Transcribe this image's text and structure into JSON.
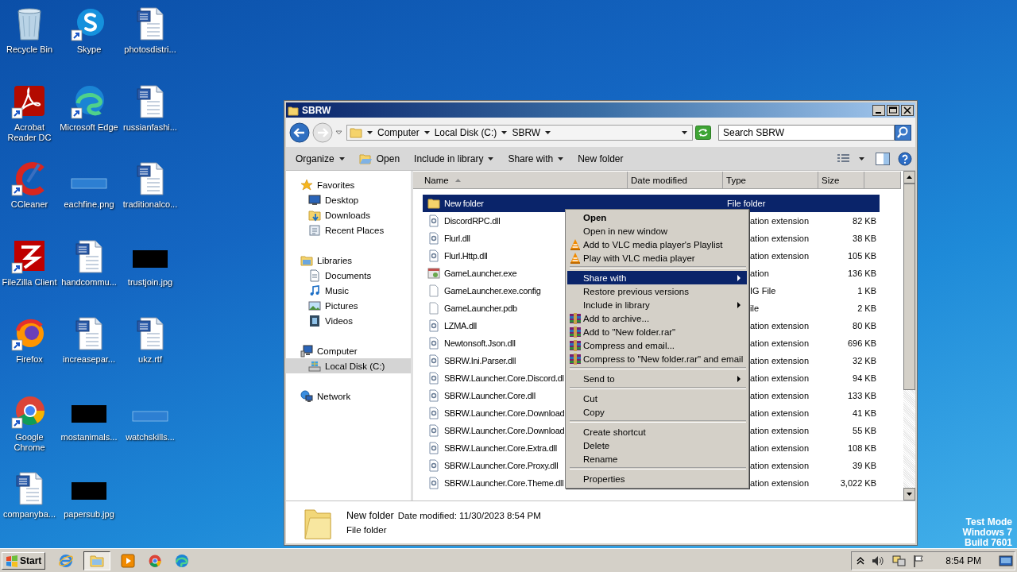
{
  "desktop": {
    "icons": [
      {
        "label": "Recycle Bin",
        "kind": "recycle"
      },
      {
        "label": "Skype",
        "kind": "skype"
      },
      {
        "label": "photosdistri...",
        "kind": "word"
      },
      {
        "label": "Acrobat Reader DC",
        "kind": "acrobat"
      },
      {
        "label": "Microsoft Edge",
        "kind": "edge"
      },
      {
        "label": "russianfashi...",
        "kind": "word"
      },
      {
        "label": "CCleaner",
        "kind": "ccleaner"
      },
      {
        "label": "eachfine.png",
        "kind": "thin-image"
      },
      {
        "label": "traditionalco...",
        "kind": "word"
      },
      {
        "label": "FileZilla Client",
        "kind": "filezilla"
      },
      {
        "label": "handcommu...",
        "kind": "word"
      },
      {
        "label": "trustjoin.jpg",
        "kind": "dark-image"
      },
      {
        "label": "Firefox",
        "kind": "firefox"
      },
      {
        "label": "increasepar...",
        "kind": "word"
      },
      {
        "label": "ukz.rtf",
        "kind": "word"
      },
      {
        "label": "Google Chrome",
        "kind": "chrome"
      },
      {
        "label": "mostanimals...",
        "kind": "dark-image"
      },
      {
        "label": "watchskills...",
        "kind": "thin-image"
      },
      {
        "label": "companyba...",
        "kind": "word"
      },
      {
        "label": "papersub.jpg",
        "kind": "dark-image"
      }
    ],
    "system_notice": [
      "Test Mode",
      "Windows 7",
      "Build 7601"
    ]
  },
  "window": {
    "title": "SBRW",
    "address": {
      "crumbs": [
        "Computer",
        "Local Disk (C:)",
        "SBRW"
      ]
    },
    "search": {
      "placeholder": "Search SBRW"
    },
    "toolbar": [
      {
        "label": "Organize",
        "kind": "menu"
      },
      {
        "label": "Open",
        "kind": "open"
      },
      {
        "label": "Include in library",
        "kind": "menu"
      },
      {
        "label": "Share with",
        "kind": "menu"
      },
      {
        "label": "New folder",
        "kind": "plain"
      }
    ],
    "navigation": [
      {
        "label": "Favorites",
        "kind": "star",
        "selected": false,
        "children": [
          {
            "label": "Desktop",
            "kind": "desktop",
            "selected": false
          },
          {
            "label": "Downloads",
            "kind": "downloads",
            "selected": false
          },
          {
            "label": "Recent Places",
            "kind": "recent",
            "selected": false
          }
        ]
      },
      {
        "label": "Libraries",
        "kind": "library",
        "selected": false,
        "children": [
          {
            "label": "Documents",
            "kind": "documents",
            "selected": false
          },
          {
            "label": "Music",
            "kind": "music",
            "selected": false
          },
          {
            "label": "Pictures",
            "kind": "pictures",
            "selected": false
          },
          {
            "label": "Videos",
            "kind": "videos",
            "selected": false
          }
        ]
      },
      {
        "label": "Computer",
        "kind": "computer",
        "selected": false,
        "children": [
          {
            "label": "Local Disk (C:)",
            "kind": "disk",
            "selected": true
          }
        ]
      },
      {
        "label": "Network",
        "kind": "network",
        "selected": false
      }
    ],
    "columns": [
      {
        "label": "Name",
        "sorted": true
      },
      {
        "label": "Date modified",
        "sorted": false
      },
      {
        "label": "Type",
        "sorted": false
      },
      {
        "label": "Size",
        "sorted": false
      }
    ],
    "rows": [
      {
        "name": "New folder",
        "kind": "folder",
        "type": "File folder",
        "selected": true,
        "covered": false
      },
      {
        "name": "DiscordRPC.dll",
        "kind": "dll",
        "type": "ation extension",
        "size": "82 KB",
        "selected": false,
        "covered": true
      },
      {
        "name": "Flurl.dll",
        "kind": "dll",
        "type": "ation extension",
        "size": "38 KB",
        "selected": false,
        "covered": true
      },
      {
        "name": "Flurl.Http.dll",
        "kind": "dll",
        "type": "ation extension",
        "size": "105 KB",
        "selected": false,
        "covered": true
      },
      {
        "name": "GameLauncher.exe",
        "kind": "exe",
        "type": "ation",
        "size": "136 KB",
        "selected": false,
        "covered": true
      },
      {
        "name": "GameLauncher.exe.config",
        "kind": "file",
        "type": "IG File",
        "size": "1 KB",
        "selected": false,
        "covered": true
      },
      {
        "name": "GameLauncher.pdb",
        "kind": "file",
        "type": "ile",
        "size": "2 KB",
        "selected": false,
        "covered": true
      },
      {
        "name": "LZMA.dll",
        "kind": "dll",
        "type": "ation extension",
        "size": "80 KB",
        "selected": false,
        "covered": true
      },
      {
        "name": "Newtonsoft.Json.dll",
        "kind": "dll",
        "type": "ation extension",
        "size": "696 KB",
        "selected": false,
        "covered": true
      },
      {
        "name": "SBRW.Ini.Parser.dll",
        "kind": "dll",
        "type": "ation extension",
        "size": "32 KB",
        "selected": false,
        "covered": true
      },
      {
        "name": "SBRW.Launcher.Core.Discord.dl",
        "kind": "dll",
        "type": "ation extension",
        "size": "94 KB",
        "selected": false,
        "covered": true
      },
      {
        "name": "SBRW.Launcher.Core.dll",
        "kind": "dll",
        "type": "ation extension",
        "size": "133 KB",
        "selected": false,
        "covered": true
      },
      {
        "name": "SBRW.Launcher.Core.Download",
        "kind": "dll",
        "type": "ation extension",
        "size": "41 KB",
        "selected": false,
        "covered": true
      },
      {
        "name": "SBRW.Launcher.Core.Download",
        "kind": "dll",
        "type": "ation extension",
        "size": "55 KB",
        "selected": false,
        "covered": true
      },
      {
        "name": "SBRW.Launcher.Core.Extra.dll",
        "kind": "dll",
        "type": "ation extension",
        "size": "108 KB",
        "selected": false,
        "covered": true
      },
      {
        "name": "SBRW.Launcher.Core.Proxy.dll",
        "kind": "dll",
        "type": "ation extension",
        "size": "39 KB",
        "selected": false,
        "covered": true
      },
      {
        "name": "SBRW.Launcher.Core.Theme.dll",
        "kind": "dll",
        "type": "ation extension",
        "size": "3,022 KB",
        "selected": false,
        "covered": true
      }
    ],
    "details": {
      "name": "New folder",
      "date": "Date modified: 11/30/2023 8:54 PM",
      "type": "File folder"
    }
  },
  "context_menu": {
    "items": [
      {
        "kind": "plain",
        "label": "Open",
        "default": true,
        "submenu": false,
        "selected": false
      },
      {
        "kind": "plain",
        "label": "Open in new window",
        "default": false,
        "submenu": false,
        "selected": false
      },
      {
        "kind": "vlc",
        "label": "Add to VLC media player's Playlist",
        "default": false,
        "submenu": false,
        "selected": false
      },
      {
        "kind": "vlc",
        "label": "Play with VLC media player",
        "default": false,
        "submenu": false,
        "selected": false
      },
      {
        "kind": "separator"
      },
      {
        "kind": "plain",
        "label": "Share with",
        "default": false,
        "submenu": true,
        "selected": true
      },
      {
        "kind": "plain",
        "label": "Restore previous versions",
        "default": false,
        "submenu": false,
        "selected": false
      },
      {
        "kind": "plain",
        "label": "Include in library",
        "default": false,
        "submenu": true,
        "selected": false
      },
      {
        "kind": "rar",
        "label": "Add to archive...",
        "default": false,
        "submenu": false,
        "selected": false
      },
      {
        "kind": "rar",
        "label": "Add to \"New folder.rar\"",
        "default": false,
        "submenu": false,
        "selected": false
      },
      {
        "kind": "rar",
        "label": "Compress and email...",
        "default": false,
        "submenu": false,
        "selected": false
      },
      {
        "kind": "rar",
        "label": "Compress to \"New folder.rar\" and email",
        "default": false,
        "submenu": false,
        "selected": false
      },
      {
        "kind": "separator"
      },
      {
        "kind": "plain",
        "label": "Send to",
        "default": false,
        "submenu": true,
        "selected": false
      },
      {
        "kind": "separator"
      },
      {
        "kind": "plain",
        "label": "Cut",
        "default": false,
        "submenu": false,
        "selected": false
      },
      {
        "kind": "plain",
        "label": "Copy",
        "default": false,
        "submenu": false,
        "selected": false
      },
      {
        "kind": "separator"
      },
      {
        "kind": "plain",
        "label": "Create shortcut",
        "default": false,
        "submenu": false,
        "selected": false
      },
      {
        "kind": "plain",
        "label": "Delete",
        "default": false,
        "submenu": false,
        "selected": false
      },
      {
        "kind": "plain",
        "label": "Rename",
        "default": false,
        "submenu": false,
        "selected": false
      },
      {
        "kind": "separator"
      },
      {
        "kind": "plain",
        "label": "Properties",
        "default": false,
        "submenu": false,
        "selected": false
      }
    ]
  },
  "taskbar": {
    "start": "Start",
    "buttons": [
      {
        "kind": "ie",
        "selected": false
      },
      {
        "kind": "explorer",
        "selected": true
      },
      {
        "kind": "media",
        "selected": false
      },
      {
        "kind": "chrome",
        "selected": false
      },
      {
        "kind": "edge",
        "selected": false
      }
    ],
    "clock": "8:54 PM"
  }
}
